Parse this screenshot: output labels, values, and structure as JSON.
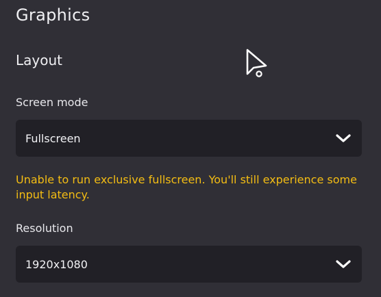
{
  "graphics": {
    "title": "Graphics",
    "layout_title": "Layout",
    "screen_mode": {
      "label": "Screen mode",
      "value": "Fullscreen",
      "icon": "chevron-down-icon"
    },
    "warning": "Unable to run exclusive fullscreen. You'll still experience some input latency.",
    "resolution": {
      "label": "Resolution",
      "value": "1920x1080",
      "icon": "chevron-down-icon"
    }
  },
  "colors": {
    "background": "#302f36",
    "select_background": "#212026",
    "warning": "#f4bd13",
    "text": "#ececef"
  }
}
